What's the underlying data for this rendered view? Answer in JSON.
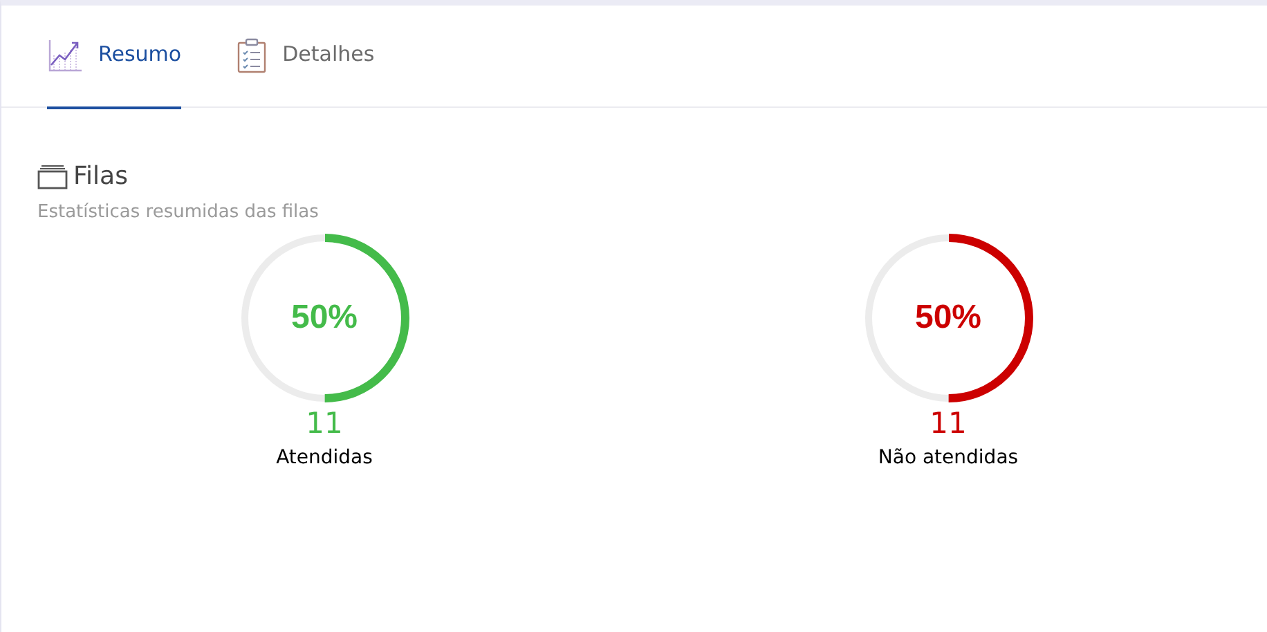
{
  "tabs": [
    {
      "label": "Resumo",
      "selected": true,
      "kind": "chart"
    },
    {
      "label": "Detalhes",
      "selected": false,
      "kind": "clipboard"
    }
  ],
  "section": {
    "title": "Filas",
    "subtitle": "Estatísticas resumidas das filas"
  },
  "gauges": [
    {
      "percent": "50%",
      "color": "#44bb4a",
      "count": "11",
      "label": "Atendidas"
    },
    {
      "percent": "50%",
      "color": "#cc0000",
      "count": "11",
      "label": "Não atendidas"
    }
  ]
}
